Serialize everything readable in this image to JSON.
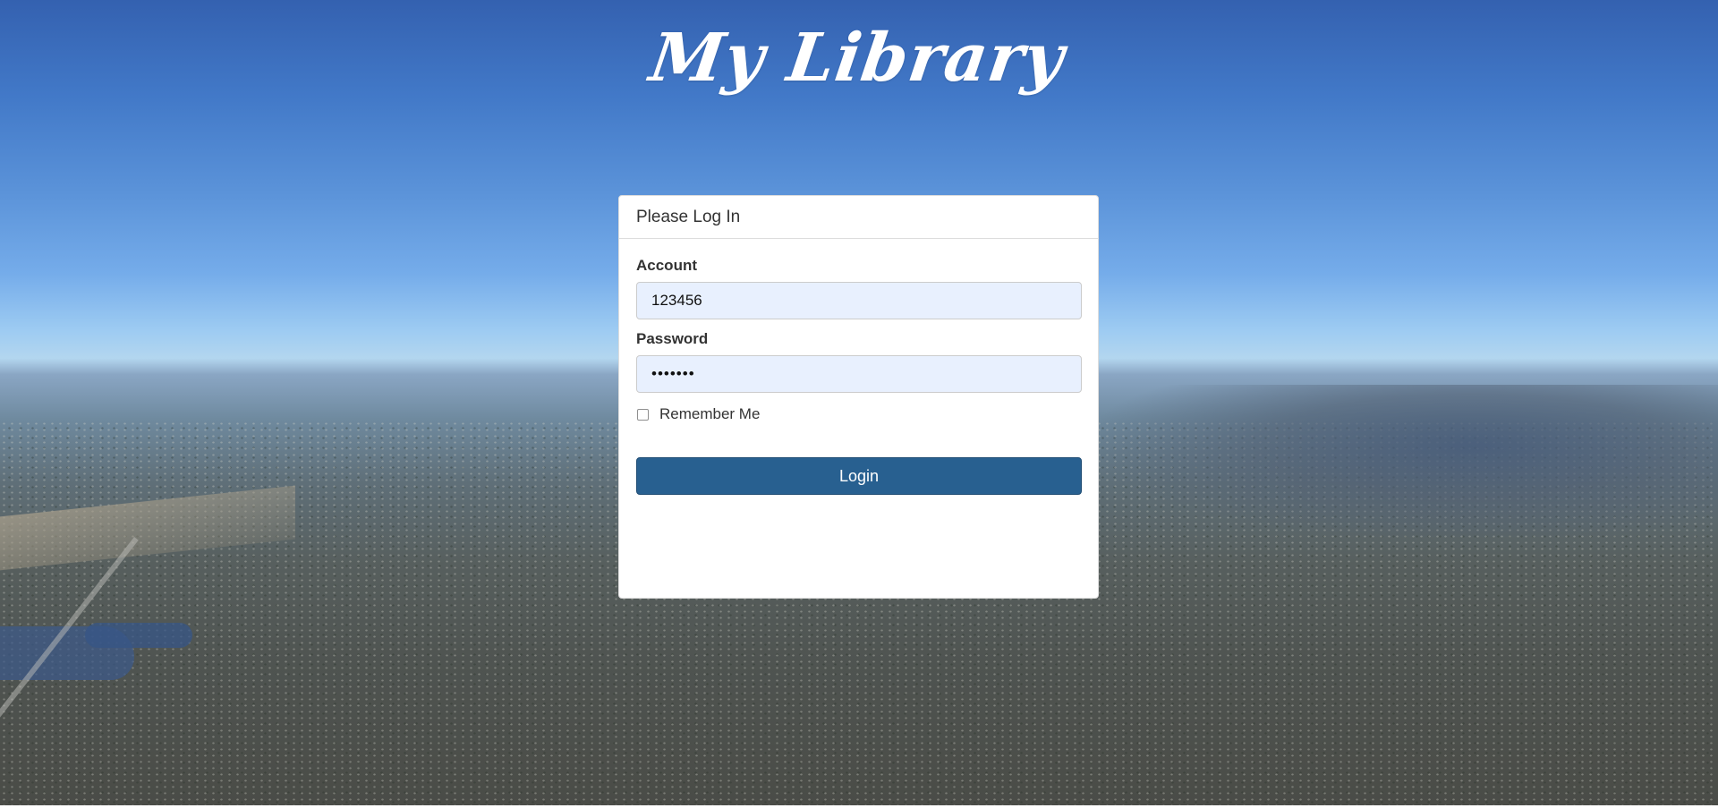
{
  "site": {
    "title": "My Library"
  },
  "login": {
    "heading": "Please Log In",
    "account_label": "Account",
    "account_value": "123456",
    "password_label": "Password",
    "password_value": "•••••••",
    "remember_label": "Remember Me",
    "remember_checked": false,
    "submit_label": "Login"
  },
  "colors": {
    "button_primary": "#286090",
    "input_autofill_bg": "#e8f0fe",
    "panel_bg": "#ffffff",
    "title_text": "#ffffff"
  }
}
